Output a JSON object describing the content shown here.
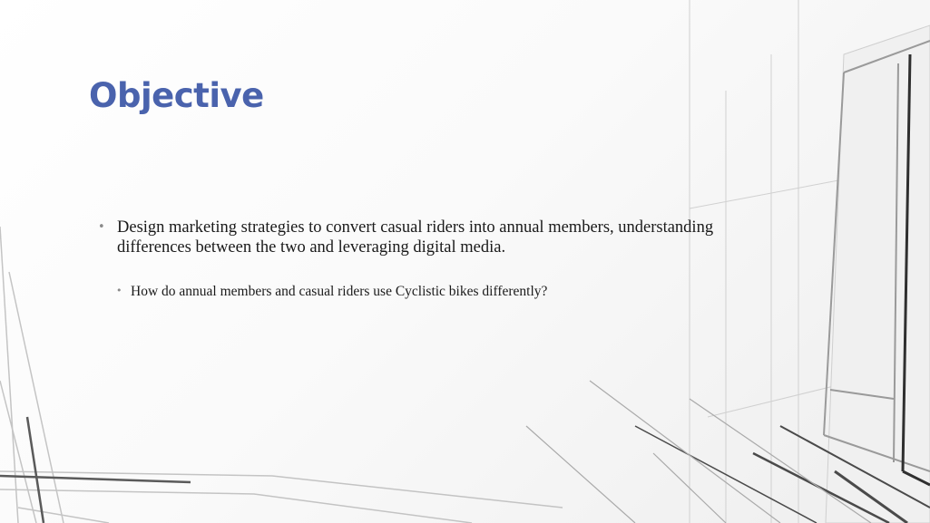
{
  "slide": {
    "title": "Objective",
    "bullets": [
      {
        "marker": "•",
        "text": "Design marketing strategies to convert casual riders into annual members, understanding differences between the two and leveraging digital media."
      }
    ],
    "sub_bullets": [
      {
        "marker": "•",
        "text": "How do annual members and casual riders use Cyclistic bikes differently?"
      }
    ]
  },
  "colors": {
    "title": "#4a63ad",
    "body_text": "#1a1a1a",
    "bullet_marker": "#8a8a8a",
    "background": "#ffffff"
  }
}
